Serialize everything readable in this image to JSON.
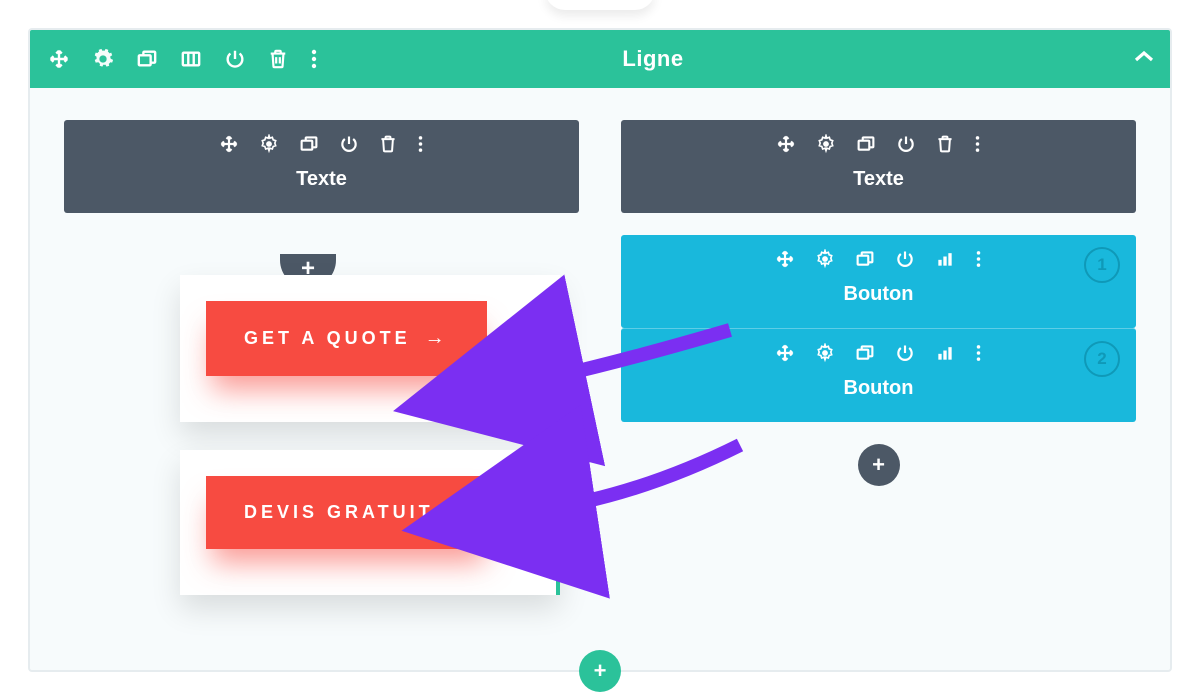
{
  "row": {
    "title": "Ligne",
    "collapse_icon": "chevron-up",
    "tools": [
      "move",
      "gear",
      "duplicate",
      "columns",
      "power",
      "trash",
      "more"
    ]
  },
  "columns": [
    {
      "modules": [
        {
          "type": "grey",
          "label": "Texte",
          "tools": [
            "move",
            "gear",
            "duplicate",
            "power",
            "trash",
            "more"
          ]
        }
      ]
    },
    {
      "modules": [
        {
          "type": "grey",
          "label": "Texte",
          "tools": [
            "move",
            "gear",
            "duplicate",
            "power",
            "trash",
            "more"
          ]
        }
      ],
      "ab_modules": [
        {
          "label": "Bouton",
          "badge": "1",
          "tools": [
            "move",
            "gear",
            "duplicate",
            "power",
            "stats",
            "more"
          ]
        },
        {
          "label": "Bouton",
          "badge": "2",
          "tools": [
            "move",
            "gear",
            "duplicate",
            "power",
            "stats",
            "more"
          ]
        }
      ]
    }
  ],
  "preview_buttons": {
    "btn1": "GET A QUOTE",
    "btn2": "DEVIS GRATUIT !",
    "arrow_glyph": "→"
  },
  "add_glyph": "+"
}
